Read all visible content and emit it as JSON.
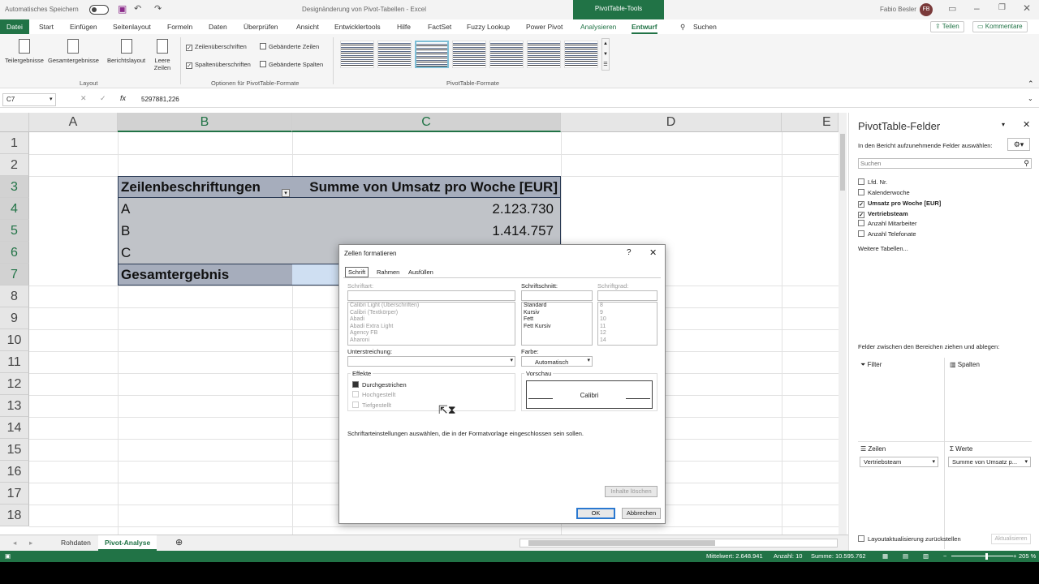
{
  "titlebar": {
    "autosave": "Automatisches Speichern",
    "doc_title": "Designänderung von Pivot-Tabellen  -  Excel",
    "context_tools": "PivotTable-Tools",
    "user": "Fabio Besler",
    "initials": "FB"
  },
  "tabs": [
    "Datei",
    "Start",
    "Einfügen",
    "Seitenlayout",
    "Formeln",
    "Daten",
    "Überprüfen",
    "Ansicht",
    "Entwicklertools",
    "Hilfe",
    "FactSet",
    "Fuzzy Lookup",
    "Power Pivot",
    "Analysieren",
    "Entwurf",
    "Suchen"
  ],
  "share": "Teilen",
  "comments": "Kommentare",
  "ribbon": {
    "layout_buttons": [
      "Teilergebnisse",
      "Gesamtergebnisse",
      "Berichtslayout",
      "Leere Zeilen"
    ],
    "layout_group": "Layout",
    "options": {
      "row_headers": "Zeilenüberschriften",
      "banded_rows": "Gebänderte Zeilen",
      "col_headers": "Spaltenüberschriften",
      "banded_cols": "Gebänderte Spalten"
    },
    "options_group": "Optionen für PivotTable-Formate",
    "styles_group": "PivotTable-Formate"
  },
  "formula": {
    "cell": "C7",
    "value": "5297881,226"
  },
  "columns": [
    "A",
    "B",
    "C",
    "D",
    "E"
  ],
  "rows": [
    "1",
    "2",
    "3",
    "4",
    "5",
    "6",
    "7",
    "8",
    "9",
    "10",
    "11",
    "12",
    "13",
    "14",
    "15",
    "16",
    "17",
    "18"
  ],
  "pivot": {
    "header_label": "Zeilenbeschriftungen",
    "header_value": "Summe von Umsatz pro Woche [EUR]",
    "rows": [
      {
        "label": "A",
        "value": "2.123.730"
      },
      {
        "label": "B",
        "value": "1.414.757"
      },
      {
        "label": "C",
        "value": ""
      }
    ],
    "total_label": "Gesamtergebnis"
  },
  "sheets": [
    "Rohdaten",
    "Pivot-Analyse"
  ],
  "status": {
    "avg": "Mittelwert: 2.648.941",
    "count": "Anzahl: 10",
    "sum": "Summe: 10.595.762",
    "zoom": "205 %"
  },
  "pane": {
    "title": "PivotTable-Felder",
    "subtitle": "In den Bericht aufzunehmende Felder auswählen:",
    "search_placeholder": "Suchen",
    "fields": [
      {
        "name": "Lfd. Nr.",
        "checked": false
      },
      {
        "name": "Kalenderwoche",
        "checked": false
      },
      {
        "name": "Umsatz pro Woche [EUR]",
        "checked": true
      },
      {
        "name": "Vertriebsteam",
        "checked": true
      },
      {
        "name": "Anzahl Mitarbeiter",
        "checked": false
      },
      {
        "name": "Anzahl Telefonate",
        "checked": false
      }
    ],
    "more_tables": "Weitere Tabellen...",
    "drag_hint": "Felder zwischen den Bereichen ziehen und ablegen:",
    "filter": "Filter",
    "columns": "Spalten",
    "rows": "Zeilen",
    "values": "Werte",
    "rows_value": "Vertriebsteam",
    "values_value": "Summe von Umsatz p...",
    "defer": "Layoutaktualisierung zurückstellen",
    "update": "Aktualisieren"
  },
  "dialog": {
    "title": "Zellen formatieren",
    "help": "?",
    "tabs": [
      "Schrift",
      "Rahmen",
      "Ausfüllen"
    ],
    "font_label": "Schriftart:",
    "fonts": [
      "Calibri Light (Überschriften)",
      "Calibri (Textkörper)",
      "Abadi",
      "Abadi Extra Light",
      "Agency FB",
      "Aharoni"
    ],
    "style_label": "Schriftschnitt:",
    "styles": [
      "Standard",
      "Kursiv",
      "Fett",
      "Fett Kursiv"
    ],
    "size_label": "Schriftgrad:",
    "sizes": [
      "8",
      "9",
      "10",
      "11",
      "12",
      "14"
    ],
    "underline_label": "Unterstreichung:",
    "color_label": "Farbe:",
    "color_value": "Automatisch",
    "effects_label": "Effekte",
    "effects": [
      "Durchgestrichen",
      "Hochgestellt",
      "Tiefgestellt"
    ],
    "preview_label": "Vorschau",
    "preview_text": "Calibri",
    "hint": "Schriftarteinstellungen auswählen, die in der Formatvorlage eingeschlossen sein sollen.",
    "clear": "Inhalte löschen",
    "ok": "OK",
    "cancel": "Abbrechen"
  }
}
